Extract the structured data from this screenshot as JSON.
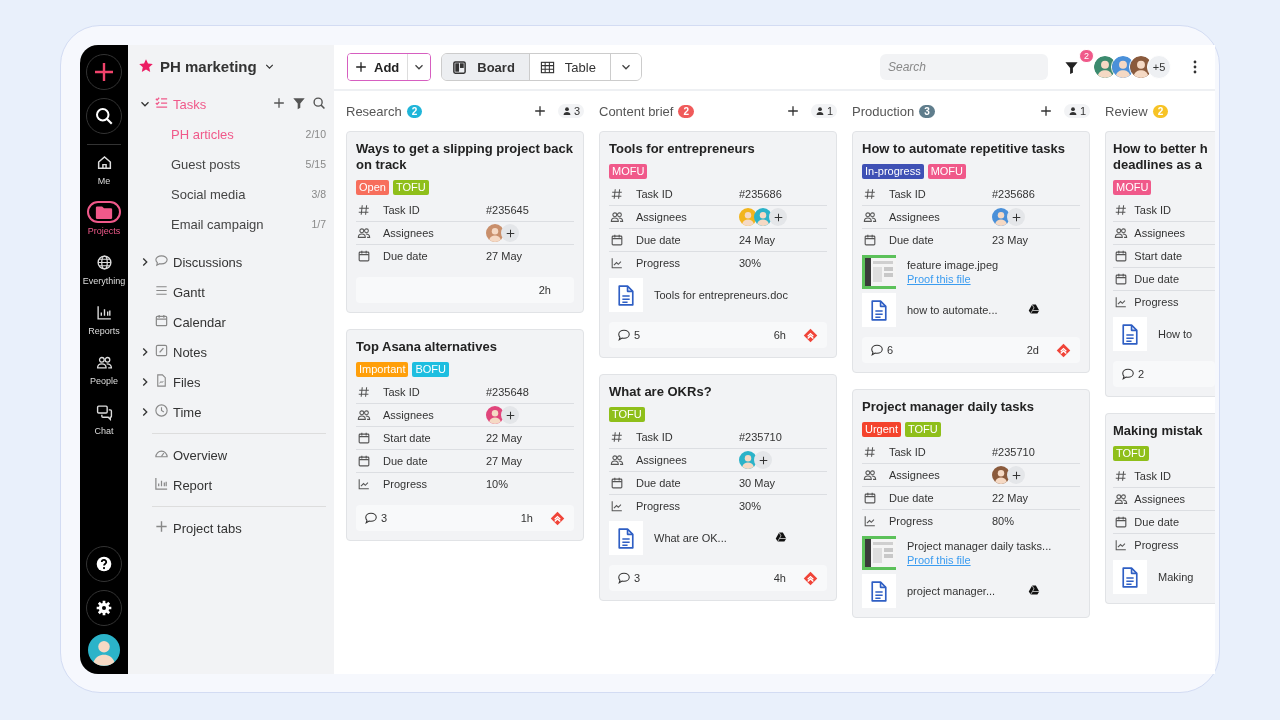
{
  "rail": {
    "items": [
      {
        "label": "Me",
        "selected": false
      },
      {
        "label": "Projects",
        "selected": true
      },
      {
        "label": "Everything",
        "selected": false
      },
      {
        "label": "Reports",
        "selected": false
      },
      {
        "label": "People",
        "selected": false
      },
      {
        "label": "Chat",
        "selected": false
      }
    ]
  },
  "sidebar": {
    "project": "PH marketing",
    "tasks": {
      "label": "Tasks",
      "expanded": true,
      "lists": [
        {
          "name": "PH articles",
          "count": "2/10",
          "selected": true
        },
        {
          "name": "Guest posts",
          "count": "5/15",
          "selected": false
        },
        {
          "name": "Social media",
          "count": "3/8",
          "selected": false
        },
        {
          "name": "Email campaign",
          "count": "1/7",
          "selected": false
        }
      ]
    },
    "nav": [
      {
        "label": "Discussions",
        "expandable": true
      },
      {
        "label": "Gantt",
        "expandable": false
      },
      {
        "label": "Calendar",
        "expandable": false
      },
      {
        "label": "Notes",
        "expandable": true
      },
      {
        "label": "Files",
        "expandable": true
      },
      {
        "label": "Time",
        "expandable": true
      }
    ],
    "extras": [
      "Overview",
      "Report"
    ],
    "add_tab": "Project tabs"
  },
  "toolbar": {
    "add": "Add",
    "views": [
      {
        "label": "Board",
        "selected": true
      },
      {
        "label": "Table",
        "selected": false
      }
    ],
    "search": {
      "placeholder": "Search"
    },
    "filter_count": "2",
    "members": [
      {
        "kind": "avatar"
      },
      {
        "kind": "avatar"
      },
      {
        "kind": "avatar"
      }
    ],
    "more_members": "+5"
  },
  "columns": [
    {
      "title": "Research",
      "count": "2",
      "color": "#1fb5d9",
      "add": true,
      "members": "3",
      "cards": [
        {
          "title": "Ways to get a slipping project back on track",
          "tags": [
            {
              "label": "Open",
              "color": "#f76e5c"
            },
            {
              "label": "TOFU",
              "color": "#8fbf1a"
            }
          ],
          "fields": [
            {
              "kind": "id",
              "label": "Task ID",
              "value": "#235645"
            },
            {
              "kind": "assignees",
              "label": "Assignees",
              "assignees": [
                {
                  "kind": "avatar"
                }
              ]
            },
            {
              "kind": "date",
              "label": "Due date",
              "value": "27 May"
            }
          ],
          "footer": {
            "time": "2h"
          }
        },
        {
          "title": "Top Asana alternatives",
          "tags": [
            {
              "label": "Important",
              "color": "#ff9f0a"
            },
            {
              "label": "BOFU",
              "color": "#1ebee0"
            }
          ],
          "fields": [
            {
              "kind": "id",
              "label": "Task ID",
              "value": "#235648"
            },
            {
              "kind": "assignees",
              "label": "Assignees",
              "assignees": [
                {
                  "kind": "avatar"
                }
              ]
            },
            {
              "kind": "date",
              "label": "Start date",
              "value": "22 May"
            },
            {
              "kind": "date",
              "label": "Due date",
              "value": "27 May"
            },
            {
              "kind": "progress",
              "label": "Progress",
              "value": "10%"
            }
          ],
          "footer": {
            "comments": "3",
            "time": "1h",
            "priority": true
          }
        }
      ]
    },
    {
      "title": "Content brief",
      "count": "2",
      "color": "#f05a5a",
      "add": true,
      "members": "1",
      "cards": [
        {
          "title": "Tools for entrepreneurs",
          "tags": [
            {
              "label": "MOFU",
              "color": "#f0598a"
            }
          ],
          "fields": [
            {
              "kind": "id",
              "label": "Task ID",
              "value": "#235686"
            },
            {
              "kind": "assignees",
              "label": "Assignees",
              "assignees": [
                {
                  "kind": "avatar"
                },
                {
                  "kind": "avatar"
                }
              ]
            },
            {
              "kind": "date",
              "label": "Due date",
              "value": "24 May"
            },
            {
              "kind": "progress",
              "label": "Progress",
              "value": "30%"
            }
          ],
          "attachments": [
            {
              "kind": "doc",
              "name": "Tools for entrepreneurs.doc"
            }
          ],
          "footer": {
            "comments": "5",
            "time": "6h",
            "priority": true
          }
        },
        {
          "title": "What are OKRs?",
          "tags": [
            {
              "label": "TOFU",
              "color": "#8fbf1a"
            }
          ],
          "fields": [
            {
              "kind": "id",
              "label": "Task ID",
              "value": "#235710"
            },
            {
              "kind": "assignees",
              "label": "Assignees",
              "assignees": [
                {
                  "kind": "avatar"
                }
              ]
            },
            {
              "kind": "date",
              "label": "Due date",
              "value": "30 May"
            },
            {
              "kind": "progress",
              "label": "Progress",
              "value": "30%"
            }
          ],
          "attachments": [
            {
              "kind": "doc",
              "name": "What are OK...",
              "drive": true
            }
          ],
          "footer": {
            "comments": "3",
            "time": "4h",
            "priority": true
          }
        }
      ]
    },
    {
      "title": "Production",
      "count": "3",
      "color": "#5f7d8c",
      "add": true,
      "members": "1",
      "cards": [
        {
          "title": "How to automate repetitive tasks",
          "tags": [
            {
              "label": "In-progress",
              "color": "#3f51b5"
            },
            {
              "label": "MOFU",
              "color": "#f0598a"
            }
          ],
          "fields": [
            {
              "kind": "id",
              "label": "Task ID",
              "value": "#235686"
            },
            {
              "kind": "assignees",
              "label": "Assignees",
              "assignees": [
                {
                  "kind": "avatar"
                }
              ]
            },
            {
              "kind": "date",
              "label": "Due date",
              "value": "23 May"
            }
          ],
          "attachments": [
            {
              "name": "feature image.jpeg",
              "link": "Proof this file"
            },
            {
              "kind": "doc",
              "name": "how to automate...",
              "drive": true
            }
          ],
          "footer": {
            "comments": "6",
            "time": "2d",
            "priority": true
          }
        },
        {
          "title": "Project manager daily tasks",
          "tags": [
            {
              "label": "Urgent",
              "color": "#f4432c"
            },
            {
              "label": "TOFU",
              "color": "#8fbf1a"
            }
          ],
          "fields": [
            {
              "kind": "id",
              "label": "Task ID",
              "value": "#235710"
            },
            {
              "kind": "assignees",
              "label": "Assignees",
              "assignees": [
                {
                  "kind": "avatar"
                }
              ]
            },
            {
              "kind": "date",
              "label": "Due date",
              "value": "22 May"
            },
            {
              "kind": "progress",
              "label": "Progress",
              "value": "80%"
            }
          ],
          "attachments": [
            {
              "name": "Project manager daily tasks...",
              "link": "Proof this file"
            },
            {
              "kind": "doc",
              "name": "project manager...",
              "drive": true
            }
          ]
        }
      ]
    },
    {
      "title": "Review",
      "count": "2",
      "color": "#f7c325",
      "cards": [
        {
          "title": [
            "How to better h",
            "deadlines as a"
          ],
          "tags": [
            {
              "label": "MOFU",
              "color": "#f0598a"
            }
          ],
          "fields": [
            {
              "kind": "id",
              "label": "Task ID"
            },
            {
              "kind": "assignees",
              "label": "Assignees"
            },
            {
              "kind": "date",
              "label": "Start date"
            },
            {
              "kind": "date",
              "label": "Due date"
            },
            {
              "kind": "progress",
              "label": "Progress"
            }
          ],
          "attachments": [
            {
              "kind": "doc",
              "name": "How to"
            }
          ],
          "footer": {
            "comments": "2"
          }
        },
        {
          "title": [
            "Making mistak"
          ],
          "tags": [
            {
              "label": "TOFU",
              "color": "#8fbf1a"
            }
          ],
          "fields": [
            {
              "kind": "id",
              "label": "Task ID"
            },
            {
              "kind": "assignees",
              "label": "Assignees"
            },
            {
              "kind": "date",
              "label": "Due date"
            },
            {
              "kind": "progress",
              "label": "Progress"
            }
          ],
          "attachments": [
            {
              "kind": "doc",
              "name": "Making"
            }
          ]
        }
      ]
    }
  ]
}
